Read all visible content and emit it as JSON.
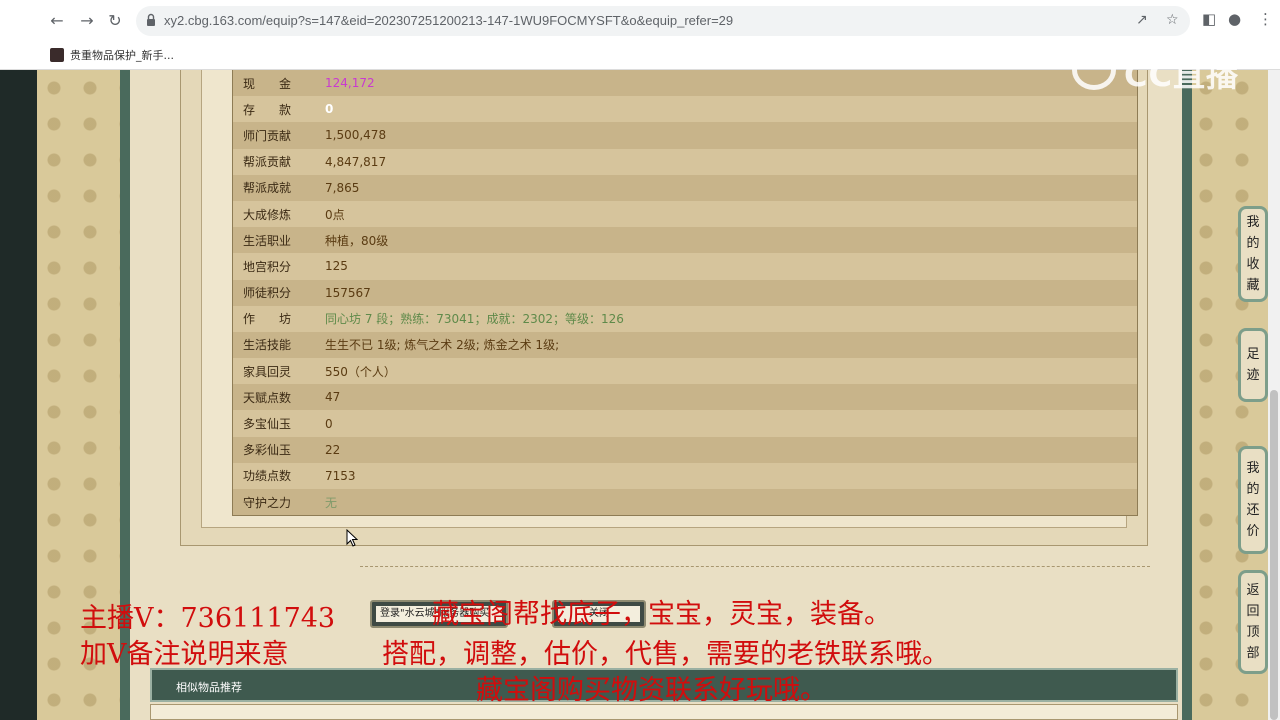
{
  "browser": {
    "url": "xy2.cbg.163.com/equip?s=147&eid=202307251200213-147-1WU9FOCMYSFT&o&equip_refer=29",
    "bookmark": "贵重物品保护_新手..."
  },
  "watermark": {
    "text": "CC直播"
  },
  "table": {
    "rows": [
      {
        "label": "现　　金",
        "value": "124,172",
        "style": "pink"
      },
      {
        "label": "存　　款",
        "value": "0",
        "style": "white"
      },
      {
        "label": "师门贡献",
        "value": "1,500,478",
        "style": ""
      },
      {
        "label": "帮派贡献",
        "value": "4,847,817",
        "style": ""
      },
      {
        "label": "帮派成就",
        "value": "7,865",
        "style": ""
      },
      {
        "label": "大成修炼",
        "value": "0点",
        "style": ""
      },
      {
        "label": "生活职业",
        "value": "种植，80级",
        "style": ""
      },
      {
        "label": "地宫积分",
        "value": "125",
        "style": ""
      },
      {
        "label": "师徒积分",
        "value": "157567",
        "style": ""
      },
      {
        "label": "作　　坊",
        "value": "同心坊 7 段；熟练：73041；成就：2302；等级：126",
        "style": "green"
      },
      {
        "label": "生活技能",
        "value": "生生不已 1级; 炼气之术 2级; 炼金之术 1级;",
        "style": ""
      },
      {
        "label": "家具回灵",
        "value": "550（个人）",
        "style": ""
      },
      {
        "label": "天赋点数",
        "value": "47",
        "style": ""
      },
      {
        "label": "多宝仙玉",
        "value": "0",
        "style": ""
      },
      {
        "label": "多彩仙玉",
        "value": "22",
        "style": ""
      },
      {
        "label": "功绩点数",
        "value": "7153",
        "style": ""
      },
      {
        "label": "守护之力",
        "value": "无",
        "style": "grey"
      }
    ]
  },
  "buttons": {
    "login": "登录\"水云城\"服务器购买",
    "close": "关闭"
  },
  "similar": {
    "title": "相似物品推荐"
  },
  "side_nav": {
    "favorites": [
      "我",
      "的",
      "收",
      "藏"
    ],
    "footprint": [
      "足",
      "迹"
    ],
    "bargain": [
      "我",
      "的",
      "还",
      "价"
    ],
    "top": [
      "返",
      "回",
      "顶",
      "部"
    ]
  },
  "overlay": {
    "line1a": "主播V：736111743",
    "line1b": "藏宝阁帮找底子，宝宝，灵宝，装备。",
    "line2a": "加V备注说明来意",
    "line2b": "搭配，调整，估价，代售，需要的老铁联系哦。",
    "line3": "藏宝阁购买物资联系好玩哦。"
  }
}
